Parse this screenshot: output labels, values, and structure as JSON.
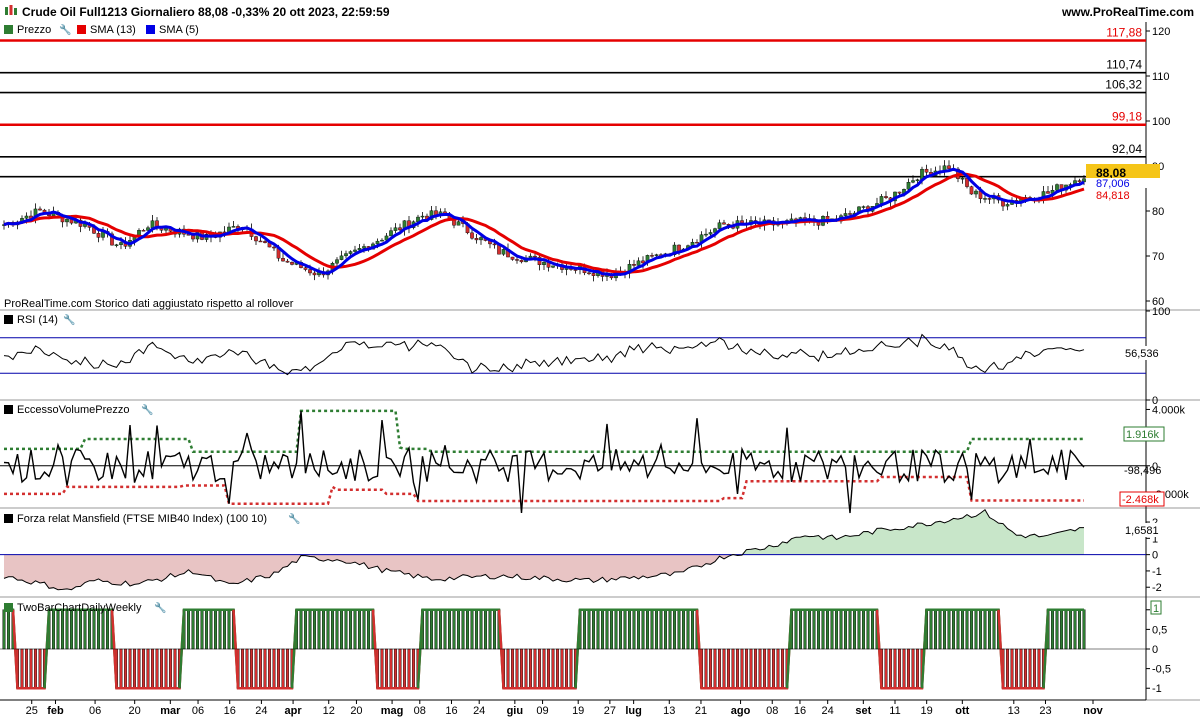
{
  "header": {
    "title": "Crude Oil Full1213 Giornaliero 88,08 -0,33% 20 ott 2023, 22:59:59",
    "site": "www.ProRealTime.com"
  },
  "colors": {
    "up": "#2e7d32",
    "down": "#d32f2f",
    "sma13": "#e50000",
    "sma5": "#0000e5",
    "rsi_band": "#0000aa",
    "price_badge_bg": "#f5c518",
    "area_pos": "#c8e6c9",
    "area_neg": "#e8c4c4",
    "bg": "#ffffff"
  },
  "panels": {
    "price": {
      "legend": [
        {
          "icon": "price-icon",
          "label": "Prezzo"
        },
        {
          "icon": "sma13-icon",
          "label": "SMA (13)"
        },
        {
          "icon": "sma5-icon",
          "label": "SMA (5)"
        }
      ],
      "watermark": "ProRealTime.com  Storico dati aggiustato rispetto al rollover",
      "last_price": "88,08",
      "sma5_value": "87,006",
      "sma13_value": "84,818"
    },
    "rsi": {
      "label": "RSI (14)",
      "value": "56,536"
    },
    "evp": {
      "label": "EccessoVolumePrezzo",
      "value": "-98,496",
      "upper": "1.916k",
      "lower": "-2.468k"
    },
    "mansfield": {
      "label": "Forza relat Mansfield (FTSE MIB40 Index) (100 10)",
      "value": "1,6581"
    },
    "twobar": {
      "label": "TwoBarChartDailyWeekly",
      "value": "1"
    }
  },
  "chart_data": [
    {
      "type": "candlestick",
      "title": "Crude Oil Full1213 Giornaliero",
      "ylim": [
        58,
        122
      ],
      "yticks": [
        60,
        70,
        80,
        90,
        100,
        110,
        120
      ],
      "ytick_labels": [
        "60",
        "70",
        "80",
        "90",
        "100",
        "110",
        "120"
      ],
      "horizontal_levels": [
        {
          "value": 117.88,
          "label": "117,88",
          "color": "#e50000"
        },
        {
          "value": 110.74,
          "label": "110,74",
          "color": "#000000"
        },
        {
          "value": 106.32,
          "label": "106,32",
          "color": "#000000"
        },
        {
          "value": 99.18,
          "label": "99,18",
          "color": "#e50000"
        },
        {
          "value": 92.04,
          "label": "92,04",
          "color": "#000000"
        },
        {
          "value": 87.62,
          "label": "87,62",
          "color": "#000000"
        }
      ],
      "close_keypoints": {
        "x": [
          0,
          8,
          18,
          26,
          32,
          45,
          53,
          62,
          70,
          80,
          93,
          98,
          110,
          118,
          135,
          150,
          160,
          170,
          185,
          197,
          203,
          210,
          215,
          222,
          232,
          240
        ],
        "y": [
          77,
          80,
          77,
          72,
          77,
          74,
          77,
          69,
          66,
          72,
          79,
          79,
          71,
          69,
          66,
          72,
          77,
          77,
          78,
          83,
          88,
          90,
          84,
          82,
          84,
          88
        ]
      },
      "series": [
        {
          "name": "Prezzo"
        },
        {
          "name": "SMA (13)"
        },
        {
          "name": "SMA (5)"
        }
      ],
      "bars": 241
    },
    {
      "type": "line",
      "title": "RSI (14)",
      "ylim": [
        0,
        100
      ],
      "yticks": [
        100,
        0
      ],
      "ytick_labels": [
        "100",
        "0"
      ],
      "bands": [
        70,
        30
      ],
      "last_value": 56.536
    },
    {
      "type": "line",
      "title": "EccessoVolumePrezzo",
      "ylim": [
        -3000,
        4600
      ],
      "yticks": [
        4000,
        0,
        -2000
      ],
      "ytick_labels": [
        "4.000k",
        "0",
        "-2.000k"
      ],
      "upper_band_steps": {
        "x": [
          0,
          18,
          42,
          66,
          67,
          88,
          89,
          95,
          215,
          240
        ],
        "y": [
          1200,
          1900,
          1000,
          3900,
          3900,
          1300,
          1200,
          1000,
          1900,
          1916
        ]
      },
      "lower_band_steps": {
        "x": [
          0,
          14,
          40,
          50,
          73,
          74,
          85,
          92,
          160,
          165,
          195,
          215,
          240
        ],
        "y": [
          -2000,
          -1500,
          -1400,
          -2700,
          -1500,
          -1700,
          -2000,
          -2500,
          -2300,
          -1100,
          -800,
          -2468,
          -2468
        ]
      },
      "last_value": -98.496
    },
    {
      "type": "area",
      "title": "Forza relat Mansfield (FTSE MIB40 Index) (100 10)",
      "ylim": [
        -2.6,
        2.8
      ],
      "yticks": [
        2,
        1,
        0,
        -1,
        -2
      ],
      "ytick_labels": [
        "2",
        "1",
        "0",
        "-1",
        "-2"
      ],
      "keypoints": {
        "x": [
          0,
          10,
          14,
          20,
          30,
          42,
          50,
          60,
          66,
          75,
          85,
          95,
          110,
          130,
          150,
          160,
          170,
          178,
          185,
          195,
          205,
          218,
          225,
          232,
          240
        ],
        "y": [
          -1.3,
          -1.9,
          -2.2,
          -1.6,
          -1.8,
          -1.0,
          -1.9,
          -1.2,
          -0.2,
          -0.3,
          -1.0,
          -1.5,
          -1.3,
          -1.6,
          -1.2,
          -0.1,
          0.5,
          1.2,
          1.0,
          1.5,
          1.9,
          2.6,
          1.2,
          1.1,
          1.6581
        ]
      },
      "last_value": 1.6581
    },
    {
      "type": "bar",
      "title": "TwoBarChartDailyWeekly",
      "ylim": [
        -1.3,
        1.3
      ],
      "yticks": [
        1,
        0.5,
        0,
        -0.5,
        -1
      ],
      "ytick_labels": [
        "1",
        "0,5",
        "0",
        "-0,5",
        "-1"
      ],
      "states": [
        {
          "from": 0,
          "to": 3,
          "v": 1
        },
        {
          "from": 3,
          "to": 10,
          "v": -1
        },
        {
          "from": 10,
          "to": 25,
          "v": 1
        },
        {
          "from": 25,
          "to": 40,
          "v": -1
        },
        {
          "from": 40,
          "to": 52,
          "v": 1
        },
        {
          "from": 52,
          "to": 65,
          "v": -1
        },
        {
          "from": 65,
          "to": 83,
          "v": 1
        },
        {
          "from": 83,
          "to": 93,
          "v": -1
        },
        {
          "from": 93,
          "to": 111,
          "v": 1
        },
        {
          "from": 111,
          "to": 128,
          "v": -1
        },
        {
          "from": 128,
          "to": 155,
          "v": 1
        },
        {
          "from": 155,
          "to": 175,
          "v": -1
        },
        {
          "from": 175,
          "to": 195,
          "v": 1
        },
        {
          "from": 195,
          "to": 205,
          "v": -1
        },
        {
          "from": 205,
          "to": 222,
          "v": 1
        },
        {
          "from": 222,
          "to": 232,
          "v": -1
        },
        {
          "from": 232,
          "to": 241,
          "v": 1
        }
      ],
      "last_value": 1
    }
  ],
  "x_axis": {
    "ticks": [
      {
        "label": "25",
        "bar": 7,
        "bold": false
      },
      {
        "label": "feb",
        "bar": 13,
        "bold": true
      },
      {
        "label": "06",
        "bar": 23,
        "bold": false
      },
      {
        "label": "20",
        "bar": 33,
        "bold": false
      },
      {
        "label": "mar",
        "bar": 42,
        "bold": true
      },
      {
        "label": "06",
        "bar": 49,
        "bold": false
      },
      {
        "label": "16",
        "bar": 57,
        "bold": false
      },
      {
        "label": "24",
        "bar": 65,
        "bold": false
      },
      {
        "label": "apr",
        "bar": 73,
        "bold": true
      },
      {
        "label": "12",
        "bar": 82,
        "bold": false
      },
      {
        "label": "20",
        "bar": 89,
        "bold": false
      },
      {
        "label": "mag",
        "bar": 98,
        "bold": true
      },
      {
        "label": "08",
        "bar": 105,
        "bold": false
      },
      {
        "label": "16",
        "bar": 113,
        "bold": false
      },
      {
        "label": "24",
        "bar": 120,
        "bold": false
      },
      {
        "label": "giu",
        "bar": 129,
        "bold": true
      },
      {
        "label": "09",
        "bar": 136,
        "bold": false
      },
      {
        "label": "19",
        "bar": 145,
        "bold": false
      },
      {
        "label": "27",
        "bar": 153,
        "bold": false
      },
      {
        "label": "lug",
        "bar": 159,
        "bold": true
      },
      {
        "label": "13",
        "bar": 168,
        "bold": false
      },
      {
        "label": "21",
        "bar": 176,
        "bold": false
      },
      {
        "label": "ago",
        "bar": 186,
        "bold": true
      },
      {
        "label": "08",
        "bar": 194,
        "bold": false
      },
      {
        "label": "16",
        "bar": 201,
        "bold": false
      },
      {
        "label": "24",
        "bar": 208,
        "bold": false
      },
      {
        "label": "set",
        "bar": 217,
        "bold": true
      },
      {
        "label": "11",
        "bar": 225,
        "bold": false
      },
      {
        "label": "19",
        "bar": 233,
        "bold": false
      },
      {
        "label": "ott",
        "bar": 242,
        "bold": true
      },
      {
        "label": "13",
        "bar": 255,
        "bold": false
      },
      {
        "label": "23",
        "bar": 263,
        "bold": false
      },
      {
        "label": "nov",
        "bar": 275,
        "bold": true
      }
    ]
  }
}
